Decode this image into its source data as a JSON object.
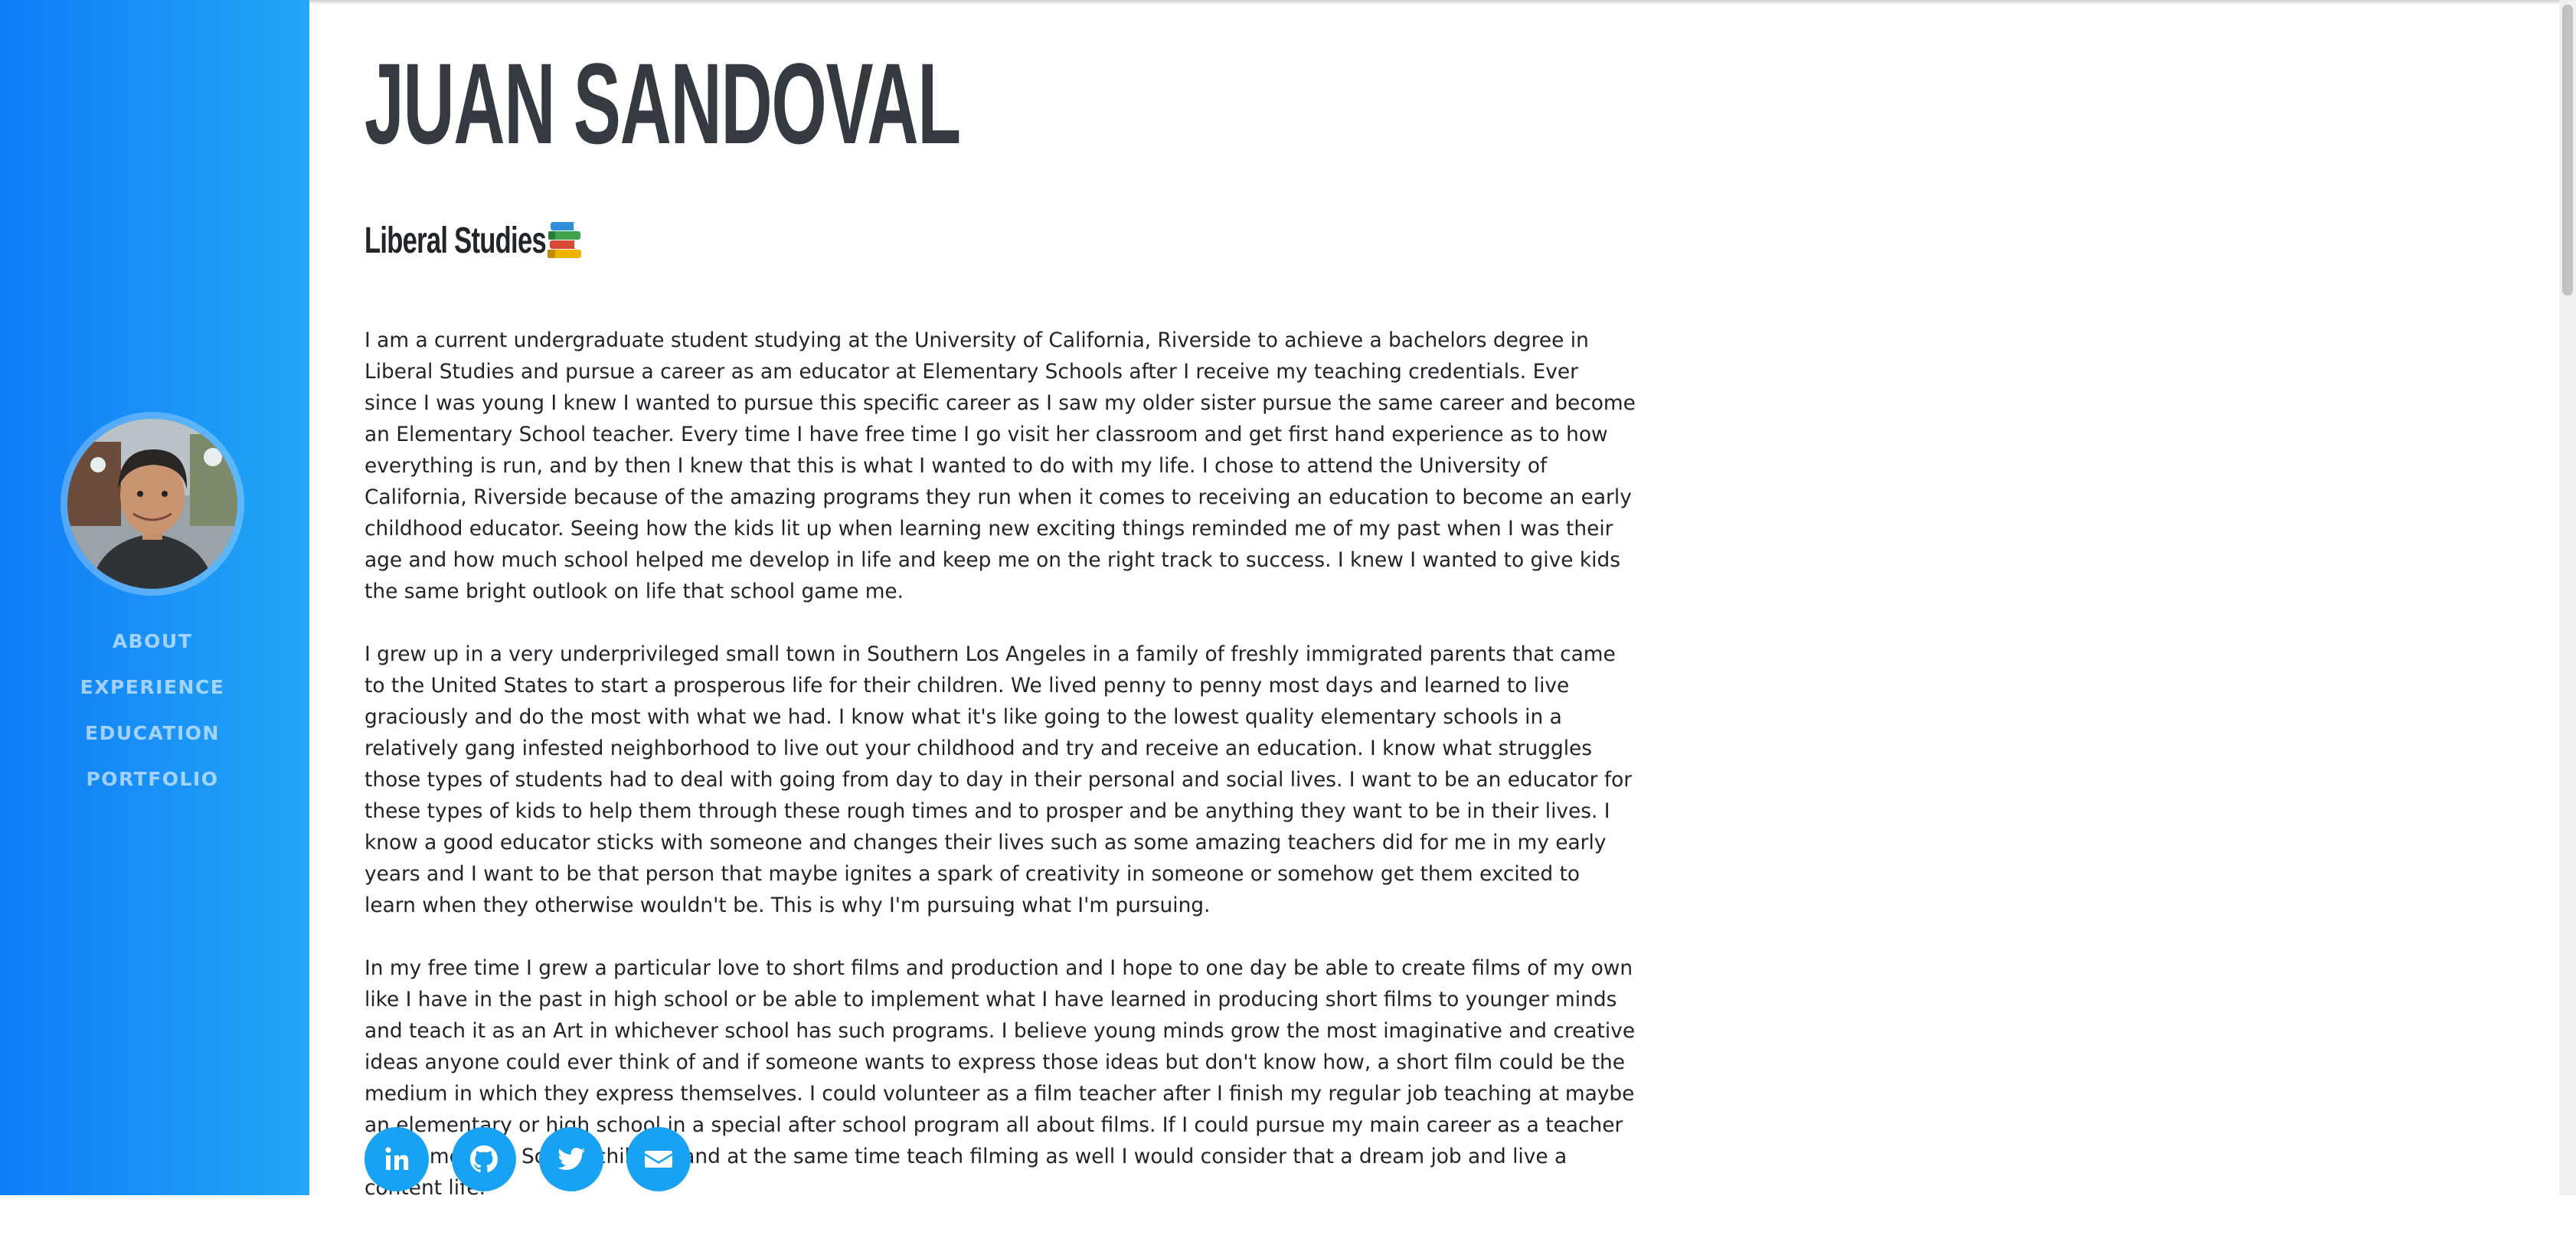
{
  "profile": {
    "name": "Juan Sandoval",
    "subtitle": "Liberal Studies"
  },
  "nav": {
    "items": [
      {
        "label": "About"
      },
      {
        "label": "Experience"
      },
      {
        "label": "Education"
      },
      {
        "label": "Portfolio"
      }
    ]
  },
  "about": {
    "paragraphs": [
      "I am a current undergraduate student studying at the University of California, Riverside to achieve a bachelors degree in Liberal Studies and pursue a career as am educator at Elementary Schools after I receive my teaching credentials. Ever since I was young I knew I wanted to pursue this specific career as I saw my older sister pursue the same career and become an Elementary School teacher. Every time I have free time I go visit her classroom and get first hand experience as to how everything is run, and by then I knew that this is what I wanted to do with my life. I chose to attend the University of California, Riverside because of the amazing programs they run when it comes to receiving an education to become an early childhood educator. Seeing how the kids lit up when learning new exciting things reminded me of my past when I was their age and how much school helped me develop in life and keep me on the right track to success. I knew I wanted to give kids the same bright outlook on life that school game me.",
      "I grew up in a very underprivileged small town in Southern Los Angeles in a family of freshly immigrated parents that came to the United States to start a prosperous life for their children. We lived penny to penny most days and learned to live graciously and do the most with what we had. I know what it's like going to the lowest quality elementary schools in a relatively gang infested neighborhood to live out your childhood and try and receive an education. I know what struggles those types of students had to deal with going from day to day in their personal and social lives. I want to be an educator for these types of kids to help them through these rough times and to prosper and be anything they want to be in their lives. I know a good educator sticks with someone and changes their lives such as some amazing teachers did for me in my early years and I want to be that person that maybe ignites a spark of creativity in someone or somehow get them excited to learn when they otherwise wouldn't be. This is why I'm pursuing what I'm pursuing.",
      "In my free time I grew a particular love to short films and production and I hope to one day be able to create films of my own like I have in the past in high school or be able to implement what I have learned in producing short films to younger minds and teach it as an Art in whichever school has such programs. I believe young minds grow the most imaginative and creative ideas anyone could ever think of and if someone wants to express those ideas but don't know how, a short film could be the medium in which they express themselves. I could volunteer as a film teacher after I finish my regular job teaching at maybe an elementary or high school in a special after school program all about films. If I could pursue my main career as a teacher for Elementary School children and at the same time teach filming as well I would consider that a dream job and live a content life."
    ]
  },
  "social": [
    {
      "icon": "linkedin-icon"
    },
    {
      "icon": "github-icon"
    },
    {
      "icon": "twitter-icon"
    },
    {
      "icon": "envelope-icon"
    }
  ],
  "colors": {
    "sidebar": "#1a93f7",
    "social": "#17a2f3",
    "heading": "#343a40"
  }
}
